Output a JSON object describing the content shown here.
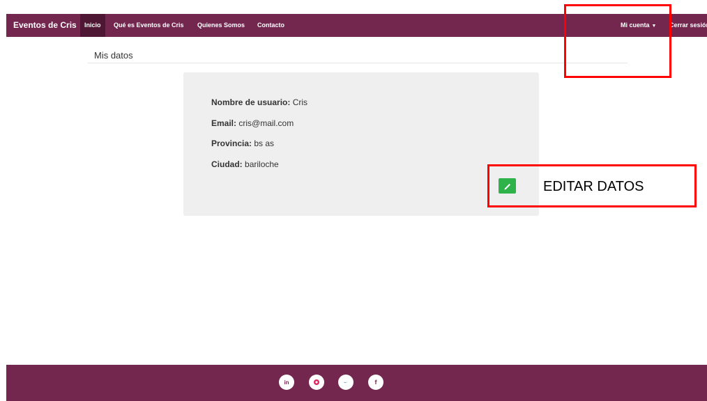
{
  "navbar": {
    "brand": "Eventos de Cris",
    "links": [
      "Inicio",
      "Qué es Eventos de Cris",
      "Quienes Somos",
      "Contacto"
    ],
    "account": "Mi cuenta",
    "logout": "Cerrar sesión"
  },
  "page": {
    "title": "Mis datos"
  },
  "profile": {
    "username_label": "Nombre de usuario:",
    "username": "Cris",
    "email_label": "Email:",
    "email": "cris@mail.com",
    "province_label": "Provincia:",
    "province": "bs as",
    "city_label": "Ciudad:",
    "city": "bariloche"
  },
  "edit": {
    "label": "EDITAR DATOS",
    "icon": "pencil-icon"
  },
  "footer": {
    "social": [
      "linkedin-icon",
      "pinterest-icon",
      "twitter-icon",
      "facebook-icon"
    ]
  },
  "colors": {
    "navbar": "#73274f",
    "active": "#4e1733",
    "edit_icon": "#2eb24a",
    "annotation": "#ff0000"
  }
}
